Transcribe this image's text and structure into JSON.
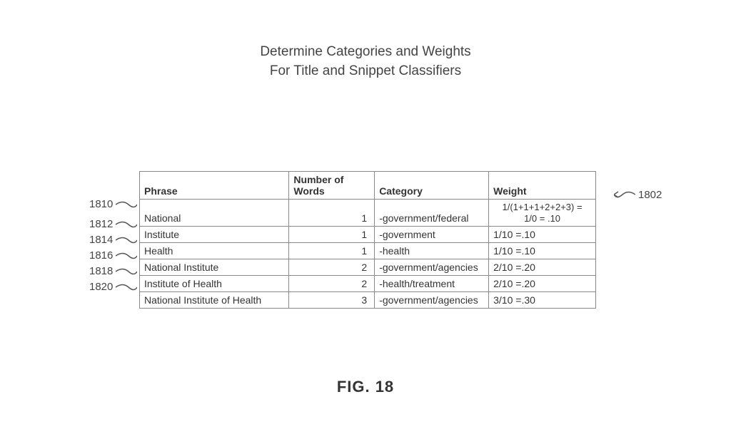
{
  "title": {
    "line1": "Determine Categories and Weights",
    "line2": "For Title and Snippet Classifiers"
  },
  "headers": {
    "phrase": "Phrase",
    "words": "Number of Words",
    "category": "Category",
    "weight": "Weight"
  },
  "rows": [
    {
      "ref": "1810",
      "phrase": "National",
      "words": "1",
      "category": "-government/federal",
      "weight_l1": "1/(1+1+1+2+2+3) =",
      "weight_l2": "1/0 = .10"
    },
    {
      "ref": "1812",
      "phrase": "Institute",
      "words": "1",
      "category": "-government",
      "weight": "1/10 =.10"
    },
    {
      "ref": "1814",
      "phrase": "Health",
      "words": "1",
      "category": "-health",
      "weight": "1/10 =.10"
    },
    {
      "ref": "1816",
      "phrase": "National Institute",
      "words": "2",
      "category": "-government/agencies",
      "weight": "2/10 =.20"
    },
    {
      "ref": "1818",
      "phrase": "Institute of Health",
      "words": "2",
      "category": "-health/treatment",
      "weight": "2/10 =.20"
    },
    {
      "ref": "1820",
      "phrase": "National Institute of Health",
      "words": "3",
      "category": "-government/agencies",
      "weight": "3/10 =.30"
    }
  ],
  "right_ref": "1802",
  "fig": "FIG. 18"
}
